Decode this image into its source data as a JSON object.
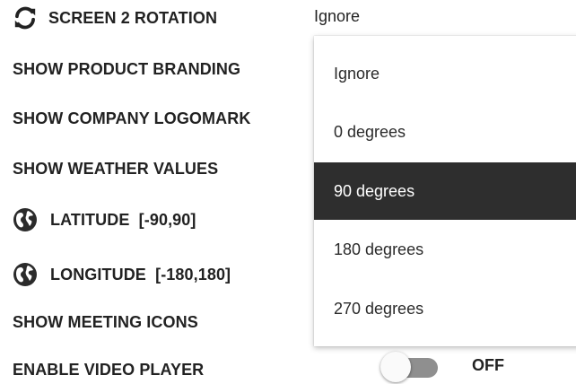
{
  "settings": {
    "screen2_rotation": "SCREEN 2 ROTATION",
    "show_product_branding": "SHOW PRODUCT BRANDING",
    "show_company_logomark": "SHOW COMPANY LOGOMARK",
    "show_weather_values": "SHOW WEATHER VALUES",
    "latitude": "LATITUDE  [-90,90]",
    "longitude": "LONGITUDE  [-180,180]",
    "show_meeting_icons": "SHOW MEETING ICONS",
    "enable_video_player": "ENABLE VIDEO PLAYER"
  },
  "rotation_select": {
    "current_value": "Ignore",
    "options": [
      "Ignore",
      "0 degrees",
      "90 degrees",
      "180 degrees",
      "270 degrees"
    ],
    "highlighted": "90 degrees"
  },
  "video_player_toggle": {
    "state_label": "OFF",
    "on": false
  },
  "icons": {
    "rotation": "sync-icon",
    "globe": "globe-icon"
  },
  "colors": {
    "highlight_bg": "#2e2e2e",
    "toggle_track": "#8f8f8f"
  }
}
